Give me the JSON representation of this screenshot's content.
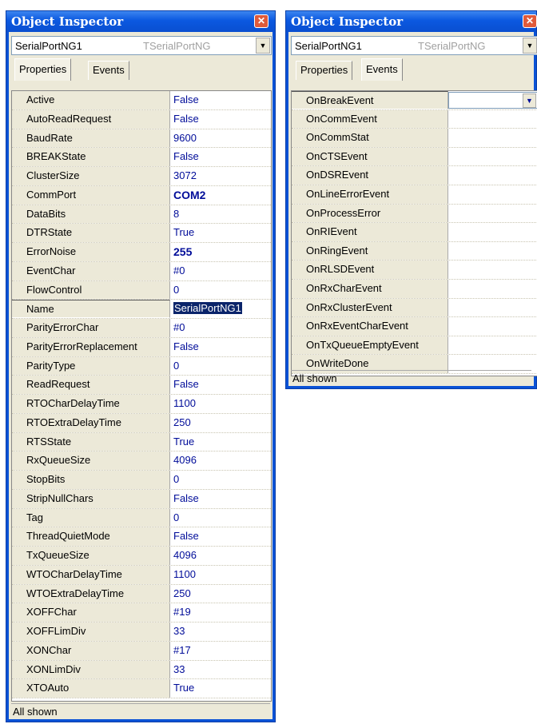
{
  "left": {
    "title": "Object Inspector",
    "object_name": "SerialPortNG1",
    "object_type": "TSerialPortNG",
    "tabs": [
      "Properties",
      "Events"
    ],
    "active_tab": "Properties",
    "properties": [
      {
        "name": "Active",
        "value": "False"
      },
      {
        "name": "AutoReadRequest",
        "value": "False"
      },
      {
        "name": "BaudRate",
        "value": "9600"
      },
      {
        "name": "BREAKState",
        "value": "False"
      },
      {
        "name": "ClusterSize",
        "value": "3072"
      },
      {
        "name": "CommPort",
        "value": "COM2",
        "bold": true
      },
      {
        "name": "DataBits",
        "value": "8"
      },
      {
        "name": "DTRState",
        "value": "True"
      },
      {
        "name": "ErrorNoise",
        "value": "255",
        "bold": true
      },
      {
        "name": "EventChar",
        "value": "#0"
      },
      {
        "name": "FlowControl",
        "value": "0"
      },
      {
        "name": "Name",
        "value": "SerialPortNG1",
        "selected": true
      },
      {
        "name": "ParityErrorChar",
        "value": "#0"
      },
      {
        "name": "ParityErrorReplacement",
        "value": "False"
      },
      {
        "name": "ParityType",
        "value": "0"
      },
      {
        "name": "ReadRequest",
        "value": "False"
      },
      {
        "name": "RTOCharDelayTime",
        "value": "1100"
      },
      {
        "name": "RTOExtraDelayTime",
        "value": "250"
      },
      {
        "name": "RTSState",
        "value": "True"
      },
      {
        "name": "RxQueueSize",
        "value": "4096"
      },
      {
        "name": "StopBits",
        "value": "0"
      },
      {
        "name": "StripNullChars",
        "value": "False"
      },
      {
        "name": "Tag",
        "value": "0"
      },
      {
        "name": "ThreadQuietMode",
        "value": "False"
      },
      {
        "name": "TxQueueSize",
        "value": "4096"
      },
      {
        "name": "WTOCharDelayTime",
        "value": "1100"
      },
      {
        "name": "WTOExtraDelayTime",
        "value": "250"
      },
      {
        "name": "XOFFChar",
        "value": "#19"
      },
      {
        "name": "XOFFLimDiv",
        "value": "33"
      },
      {
        "name": "XONChar",
        "value": "#17"
      },
      {
        "name": "XONLimDiv",
        "value": "33"
      },
      {
        "name": "XTOAuto",
        "value": "True"
      }
    ],
    "status": "All shown"
  },
  "right": {
    "title": "Object Inspector",
    "object_name": "SerialPortNG1",
    "object_type": "TSerialPortNG",
    "tabs": [
      "Properties",
      "Events"
    ],
    "active_tab": "Events",
    "events": [
      {
        "name": "OnBreakEvent",
        "value": "",
        "selected": true
      },
      {
        "name": "OnCommEvent",
        "value": ""
      },
      {
        "name": "OnCommStat",
        "value": ""
      },
      {
        "name": "OnCTSEvent",
        "value": ""
      },
      {
        "name": "OnDSREvent",
        "value": ""
      },
      {
        "name": "OnLineErrorEvent",
        "value": ""
      },
      {
        "name": "OnProcessError",
        "value": ""
      },
      {
        "name": "OnRIEvent",
        "value": ""
      },
      {
        "name": "OnRingEvent",
        "value": ""
      },
      {
        "name": "OnRLSDEvent",
        "value": ""
      },
      {
        "name": "OnRxCharEvent",
        "value": ""
      },
      {
        "name": "OnRxClusterEvent",
        "value": ""
      },
      {
        "name": "OnRxEventCharEvent",
        "value": ""
      },
      {
        "name": "OnTxQueueEmptyEvent",
        "value": ""
      },
      {
        "name": "OnWriteDone",
        "value": ""
      }
    ],
    "status": "All shown"
  },
  "icons": {
    "close": "close-icon",
    "dropdown": "chevron-down-icon"
  },
  "colors": {
    "titlebar": "#0a52d6",
    "value_text": "#000c99",
    "selection": "#0a246a",
    "panel": "#ece9d8"
  }
}
